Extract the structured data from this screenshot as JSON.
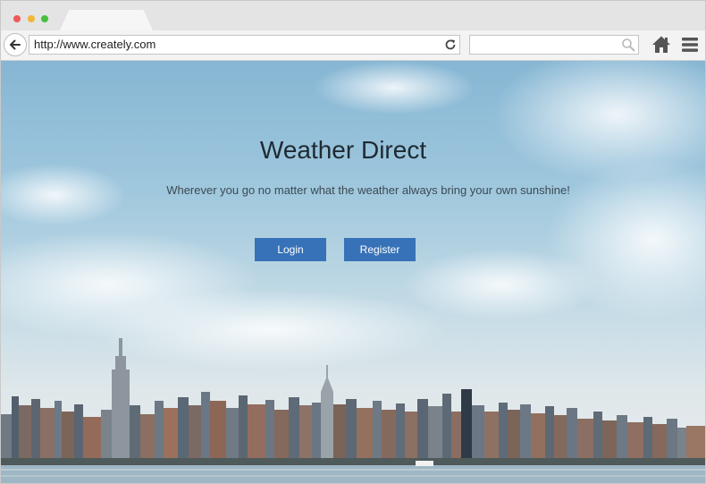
{
  "browser": {
    "url": "http://www.creately.com",
    "search_placeholder": "",
    "colors": {
      "close": "#ee5a5a",
      "minimize": "#f1b63a",
      "maximize": "#46c03f"
    },
    "icons": [
      "back-arrow-icon",
      "reload-icon",
      "search-icon",
      "home-icon",
      "menu-icon"
    ]
  },
  "hero": {
    "title": "Weather Direct",
    "subtitle": "Wherever you go no matter what the weather always bring your own sunshine!",
    "login_label": "Login",
    "register_label": "Register",
    "button_color": "#3772b8"
  }
}
